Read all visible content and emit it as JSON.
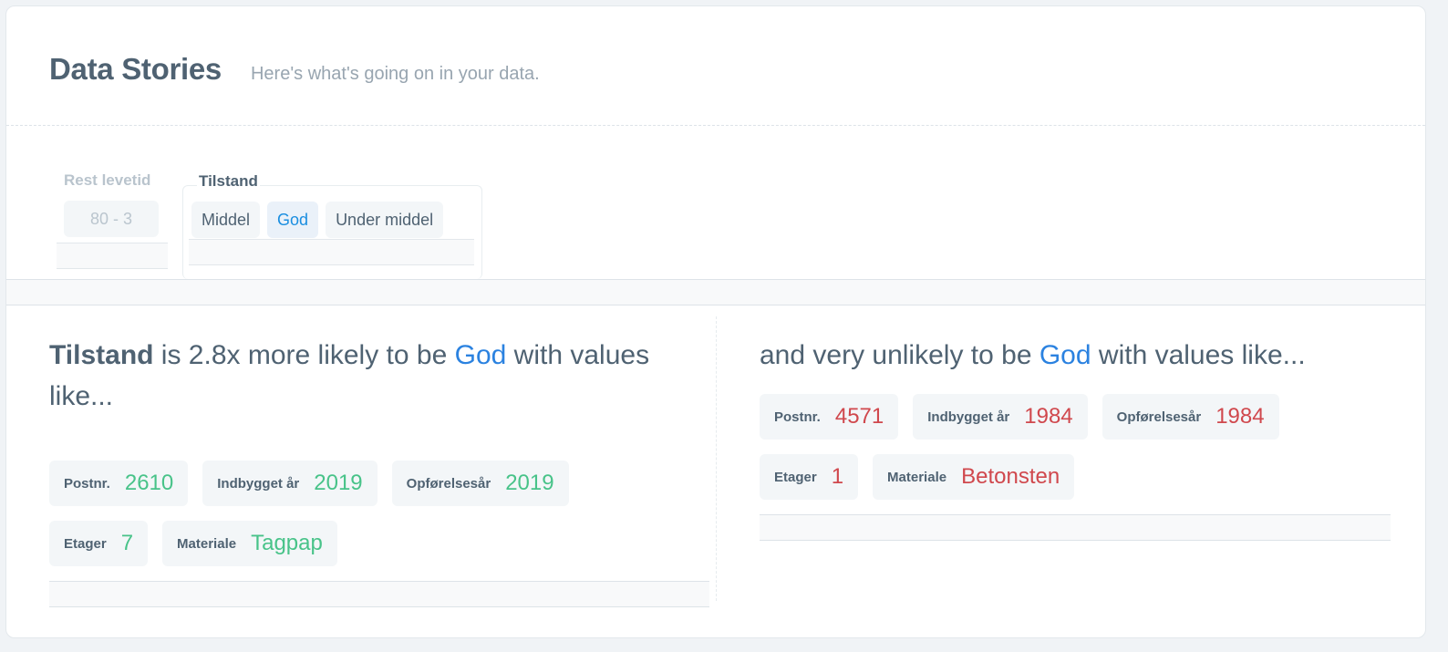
{
  "header": {
    "title": "Data Stories",
    "subtitle": "Here's what's going on in your data."
  },
  "filters": {
    "rest": {
      "label": "Rest levetid",
      "value": "80 - 3"
    },
    "tilstand": {
      "label": "Tilstand",
      "options": [
        "Middel",
        "God",
        "Under middel"
      ],
      "selected": "God"
    }
  },
  "story_left": {
    "subject": "Tilstand",
    "text_mid": " is 2.8x more likely to be ",
    "value": "God",
    "text_end": " with values like...",
    "pills": [
      {
        "label": "Postnr.",
        "value": "2610"
      },
      {
        "label": "Indbygget år",
        "value": "2019"
      },
      {
        "label": "Opførelsesår",
        "value": "2019"
      },
      {
        "label": "Etager",
        "value": "7"
      },
      {
        "label": "Materiale",
        "value": "Tagpap"
      }
    ]
  },
  "story_right": {
    "text_start": "and very unlikely to be ",
    "value": "God",
    "text_end": " with values like...",
    "pills": [
      {
        "label": "Postnr.",
        "value": "4571"
      },
      {
        "label": "Indbygget år",
        "value": "1984"
      },
      {
        "label": "Opførelsesår",
        "value": "1984"
      },
      {
        "label": "Etager",
        "value": "1"
      },
      {
        "label": "Materiale",
        "value": "Betonsten"
      }
    ]
  },
  "colors": {
    "accent": "#2b82e0",
    "positive": "#48c389",
    "negative": "#d0484d"
  }
}
